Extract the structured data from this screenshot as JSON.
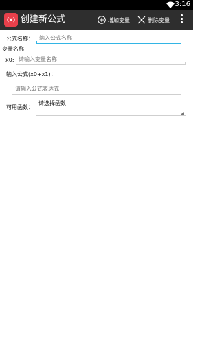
{
  "status_bar": {
    "time": "3:16",
    "wifi_icon": "wifi-icon"
  },
  "app_bar": {
    "icon_text": "(x)",
    "title": "创建新公式",
    "add_variable": "增加变量",
    "delete_variable": "删除变量"
  },
  "form": {
    "formula_name_label": "公式名称：",
    "formula_name_placeholder": "输入公式名称",
    "variable_name_heading": "变量名称",
    "x0_label": "x0:",
    "x0_placeholder": "请输入变量名称",
    "formula_label": "输入公式(x0+x1)：",
    "formula_placeholder": "请输入公式表达式",
    "functions_label": "可用函数：",
    "functions_value": "请选择函数"
  },
  "colors": {
    "accent": "#33b5e5",
    "app_bar": "#2e2e2e",
    "app_icon": "#e8404b"
  }
}
